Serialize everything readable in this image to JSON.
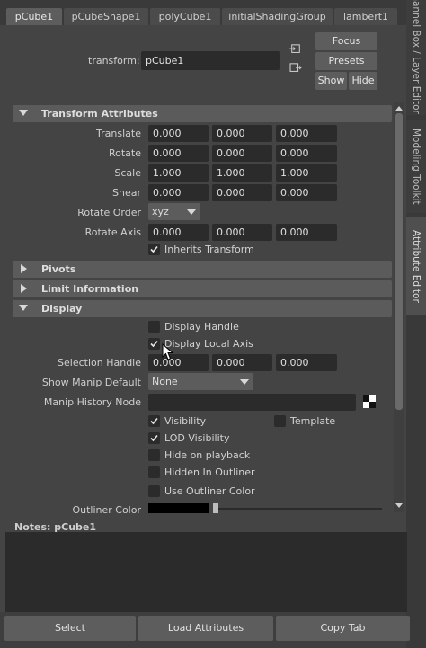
{
  "tabs": [
    {
      "label": "pCube1",
      "active": true
    },
    {
      "label": "pCubeShape1",
      "active": false
    },
    {
      "label": "polyCube1",
      "active": false
    },
    {
      "label": "initialShadingGroup",
      "active": false
    },
    {
      "label": "lambert1",
      "active": false
    }
  ],
  "side_tabs": [
    {
      "label": "Channel Box / Layer Editor"
    },
    {
      "label": "Modeling Toolkit"
    },
    {
      "label": "Attribute Editor"
    }
  ],
  "header": {
    "transform_label": "transform:",
    "transform_value": "pCube1",
    "focus": "Focus",
    "presets": "Presets",
    "show": "Show",
    "hide": "Hide"
  },
  "transform_section": {
    "title": "Transform Attributes",
    "translate": {
      "label": "Translate",
      "x": "0.000",
      "y": "0.000",
      "z": "0.000"
    },
    "rotate": {
      "label": "Rotate",
      "x": "0.000",
      "y": "0.000",
      "z": "0.000"
    },
    "scale": {
      "label": "Scale",
      "x": "1.000",
      "y": "1.000",
      "z": "1.000"
    },
    "shear": {
      "label": "Shear",
      "x": "0.000",
      "y": "0.000",
      "z": "0.000"
    },
    "rotate_order": {
      "label": "Rotate Order",
      "value": "xyz"
    },
    "rotate_axis": {
      "label": "Rotate Axis",
      "x": "0.000",
      "y": "0.000",
      "z": "0.000"
    },
    "inherits_transform": {
      "label": "Inherits Transform",
      "checked": true
    }
  },
  "pivots_section": {
    "title": "Pivots"
  },
  "limit_section": {
    "title": "Limit Information"
  },
  "display_section": {
    "title": "Display",
    "display_handle": {
      "label": "Display Handle",
      "checked": false
    },
    "display_local_axis": {
      "label": "Display Local Axis",
      "checked": true
    },
    "selection_handle": {
      "label": "Selection Handle",
      "x": "0.000",
      "y": "0.000",
      "z": "0.000"
    },
    "show_manip_default": {
      "label": "Show Manip Default",
      "value": "None"
    },
    "manip_history_node": {
      "label": "Manip History Node",
      "value": ""
    },
    "visibility": {
      "label": "Visibility",
      "checked": true
    },
    "template": {
      "label": "Template",
      "checked": false
    },
    "lod_visibility": {
      "label": "LOD Visibility",
      "checked": true
    },
    "hide_on_playback": {
      "label": "Hide on playback",
      "checked": false
    },
    "hidden_in_outliner": {
      "label": "Hidden In Outliner",
      "checked": false
    },
    "use_outliner_color": {
      "label": "Use Outliner Color",
      "checked": false
    },
    "outliner_color": {
      "label": "Outliner Color",
      "swatch": "#000000"
    }
  },
  "notes": {
    "label": "Notes:  pCube1",
    "text": ""
  },
  "footer": {
    "select": "Select",
    "load_attributes": "Load Attributes",
    "copy_tab": "Copy Tab"
  },
  "colors": {
    "panel": "#444444",
    "field": "#2b2b2b",
    "section": "#5b5b5b",
    "button": "#5d5d5d"
  }
}
